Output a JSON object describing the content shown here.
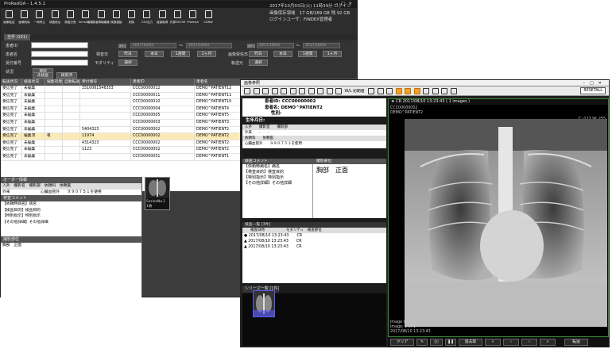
{
  "main": {
    "title": "ProRadQA - 1.4.5.1",
    "toolbar": [
      "画像転送",
      "画像削除",
      "一時停止",
      "検査統合",
      "検査分割",
      "Series編集",
      "患者情報編集",
      "検査複製",
      "削除",
      "CSV出力",
      "複製取得",
      "外部DICOM",
      "Prefetch",
      "CDRW"
    ],
    "info": [
      "2017年10月03日(火) 11時39分 ログイン",
      "画像保存領域　17 GB/189 GB  残 92 GB",
      "ログインユーザ：FINDEX管理者"
    ],
    "tab": "全件 (151)",
    "search": {
      "patient_id": "患者ID",
      "patient_name": "患者名",
      "accession": "受付番号",
      "status": "状況",
      "exam_date": "検査日",
      "modality": "モダリティ",
      "period": "期間",
      "image_received": "画像受信日",
      "transfer": "転送元",
      "btn_yesterday": "昨日",
      "btn_today": "本日",
      "btn_week": "1週間",
      "btn_month": "1ヶ月",
      "btn_select": "選択",
      "btn_unsearched": "未検査",
      "btn_search": "検索済",
      "date_ph": "2017/10/03"
    },
    "columns": [
      "転送状況",
      "検査状況",
      "編集有無",
      "自動転送",
      "受付番号",
      "患者ID",
      "患者名"
    ],
    "rows": [
      {
        "a": "受信完了",
        "b": "未編集",
        "c": "",
        "d": "",
        "e": "1510061546353",
        "f": "CCC00000012",
        "g": "DEMO^PATIENT12"
      },
      {
        "a": "受信完了",
        "b": "未編集",
        "c": "",
        "d": "",
        "e": "",
        "f": "CCC00000011",
        "g": "DEMO^PATIENT11"
      },
      {
        "a": "受信完了",
        "b": "未編集",
        "c": "",
        "d": "",
        "e": "",
        "f": "CCC00000010",
        "g": "DEMO^PATIENT10"
      },
      {
        "a": "受信完了",
        "b": "未編集",
        "c": "",
        "d": "",
        "e": "",
        "f": "CCC00000004",
        "g": "DEMO^PATIENT4"
      },
      {
        "a": "受信完了",
        "b": "未編集",
        "c": "",
        "d": "",
        "e": "",
        "f": "CCC00000005",
        "g": "DEMO^PATIENT5"
      },
      {
        "a": "受信完了",
        "b": "未編集",
        "c": "",
        "d": "",
        "e": "",
        "f": "CCC00000003",
        "g": "DEMO^PATIENT3"
      },
      {
        "a": "受信完了",
        "b": "未編集",
        "c": "",
        "d": "",
        "e": "5404323",
        "f": "CCC00000002",
        "g": "DEMO^PATIENT2"
      },
      {
        "a": "受信完了",
        "b": "編集済",
        "c": "有",
        "d": "",
        "e": "11974",
        "f": "CCC00000002",
        "g": "DEMO^PATIENT2"
      },
      {
        "a": "受信完了",
        "b": "未編集",
        "c": "",
        "d": "",
        "e": "4314323",
        "f": "CCC00000002",
        "g": "DEMO^PATIENT2"
      },
      {
        "a": "受信完了",
        "b": "未編集",
        "c": "",
        "d": "",
        "e": "1123",
        "f": "CCC00000002",
        "g": "DEMO^PATIENT2"
      },
      {
        "a": "受信完了",
        "b": "未編集",
        "c": "",
        "d": "",
        "e": "",
        "f": "CCC00000001",
        "g": "DEMO^PATIENT1"
      }
    ],
    "order": {
      "title": "オーダー情報",
      "cols": "入外　撮影名　撮影部　依頼科　依頼医",
      "vals": "外来　　　　　　　　心臓血管外　　９９０７５１を使用",
      "comment_title": "検査コメント",
      "comments": [
        "【依頼時病名】病名",
        "【検査目的】検査目的",
        "【特別指示】特別指示",
        "【その他詳細】その他詳細"
      ],
      "part_title": "撮影部位",
      "part": "胸部　正面"
    },
    "thumb": {
      "label": "SeriesNo.1",
      "count": "1枚"
    }
  },
  "viewer": {
    "title": "画像参照",
    "wl": "W/L 初期値",
    "reset": "RESETALL",
    "patient_id": "患者ID: CCC00000002",
    "patient_name": "患者名: DEMO^PATIENT2",
    "sex": "性別:",
    "birth": "生年月日:",
    "exam_cols": "入外　　撮影室　　撮影部",
    "exam_vals": "外来　　-　　-",
    "req_cols": "依頼科　　依頼医",
    "req_vals": "心臓血管外　　９９０７５１を使用",
    "comment_title": "検査コメント",
    "part_title": "撮影部位",
    "comments": [
      "【依頼時病名】病名",
      "【検査目的】検査目的",
      "【特別指示】特別指示",
      "【その他詳細】その他詳細"
    ],
    "part": "胸部　正面",
    "study_title": "検査一覧 [3件]",
    "study_cols": "検査日時　　　　　　モダリティ　検査部位",
    "studies": [
      {
        "date": "2017/08/10 13:23:43",
        "mod": "CR"
      },
      {
        "date": "2017/08/10 13:23:43",
        "mod": "CR"
      },
      {
        "date": "2017/08/10 13:23:43",
        "mod": "CR"
      }
    ],
    "series_title": "シリーズ一覧 [1件]",
    "view_header": "★  CR  2017/08/10 13:23:43  ( 1 images )",
    "view_id": "CCC00000002",
    "view_name": "DEMO^PATIENT2",
    "wlvalue": "C:-127  W: 255",
    "img_no": "Image no: 1",
    "img_of": "Image: 1 of 1",
    "img_date": "2017/08/10 13:23:43",
    "buttons": [
      "クリア",
      "",
      "",
      "",
      "過去取",
      "«",
      "‹",
      "›",
      "»",
      "転送"
    ]
  },
  "colors": {
    "dark": "#2d2d2d",
    "select_row": "#fbe9b7",
    "accent": "#f0a030"
  }
}
